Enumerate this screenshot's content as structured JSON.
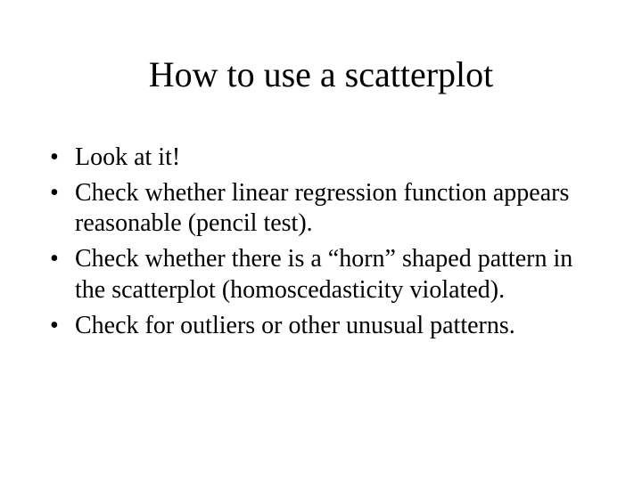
{
  "slide": {
    "title": "How to use a scatterplot",
    "bullets": [
      "Look at it!",
      "Check whether linear regression function appears reasonable (pencil test).",
      "Check whether there is a “horn” shaped pattern in the scatterplot (homoscedasticity violated).",
      "Check for outliers or other unusual patterns."
    ]
  }
}
